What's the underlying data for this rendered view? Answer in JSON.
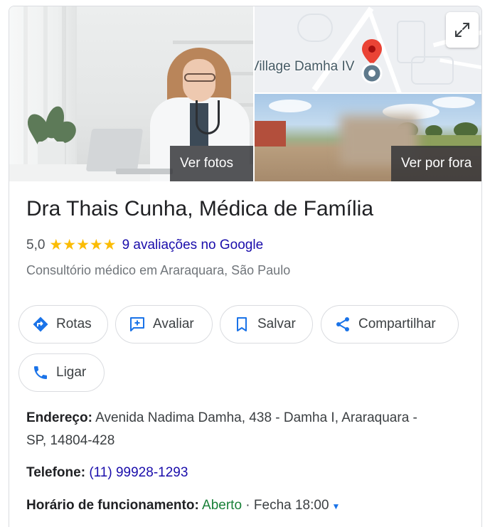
{
  "photos": {
    "main_label": "Ver fotos",
    "street_label": "Ver por fora"
  },
  "map": {
    "place_label": "Village Damha IV",
    "pin_color": "#ea4335"
  },
  "business": {
    "name": "Dra Thais Cunha, Médica de Família",
    "rating_value": "5,0",
    "stars": "★★★★★",
    "star_count": 5,
    "reviews_link": "9 avaliações no Google",
    "category": "Consultório médico em Araraquara, São Paulo"
  },
  "actions": {
    "directions": "Rotas",
    "review": "Avaliar",
    "save": "Salvar",
    "share": "Compartilhar",
    "call": "Ligar"
  },
  "details": {
    "address_label": "Endereço:",
    "address_line1": "Avenida Nadima Damha, 438 - Damha I, Araraquara -",
    "address_line2": "SP, 14804-428",
    "phone_label": "Telefone:",
    "phone_value": "(11) 99928-1293",
    "hours_label": "Horário de funcionamento:",
    "hours_status": "Aberto",
    "hours_separator": " · ",
    "hours_close": "Fecha 18:00"
  },
  "colors": {
    "accent_blue": "#1a73e8",
    "link_blue": "#1a0dab",
    "open_green": "#188038",
    "star_yellow": "#fbbc04"
  }
}
